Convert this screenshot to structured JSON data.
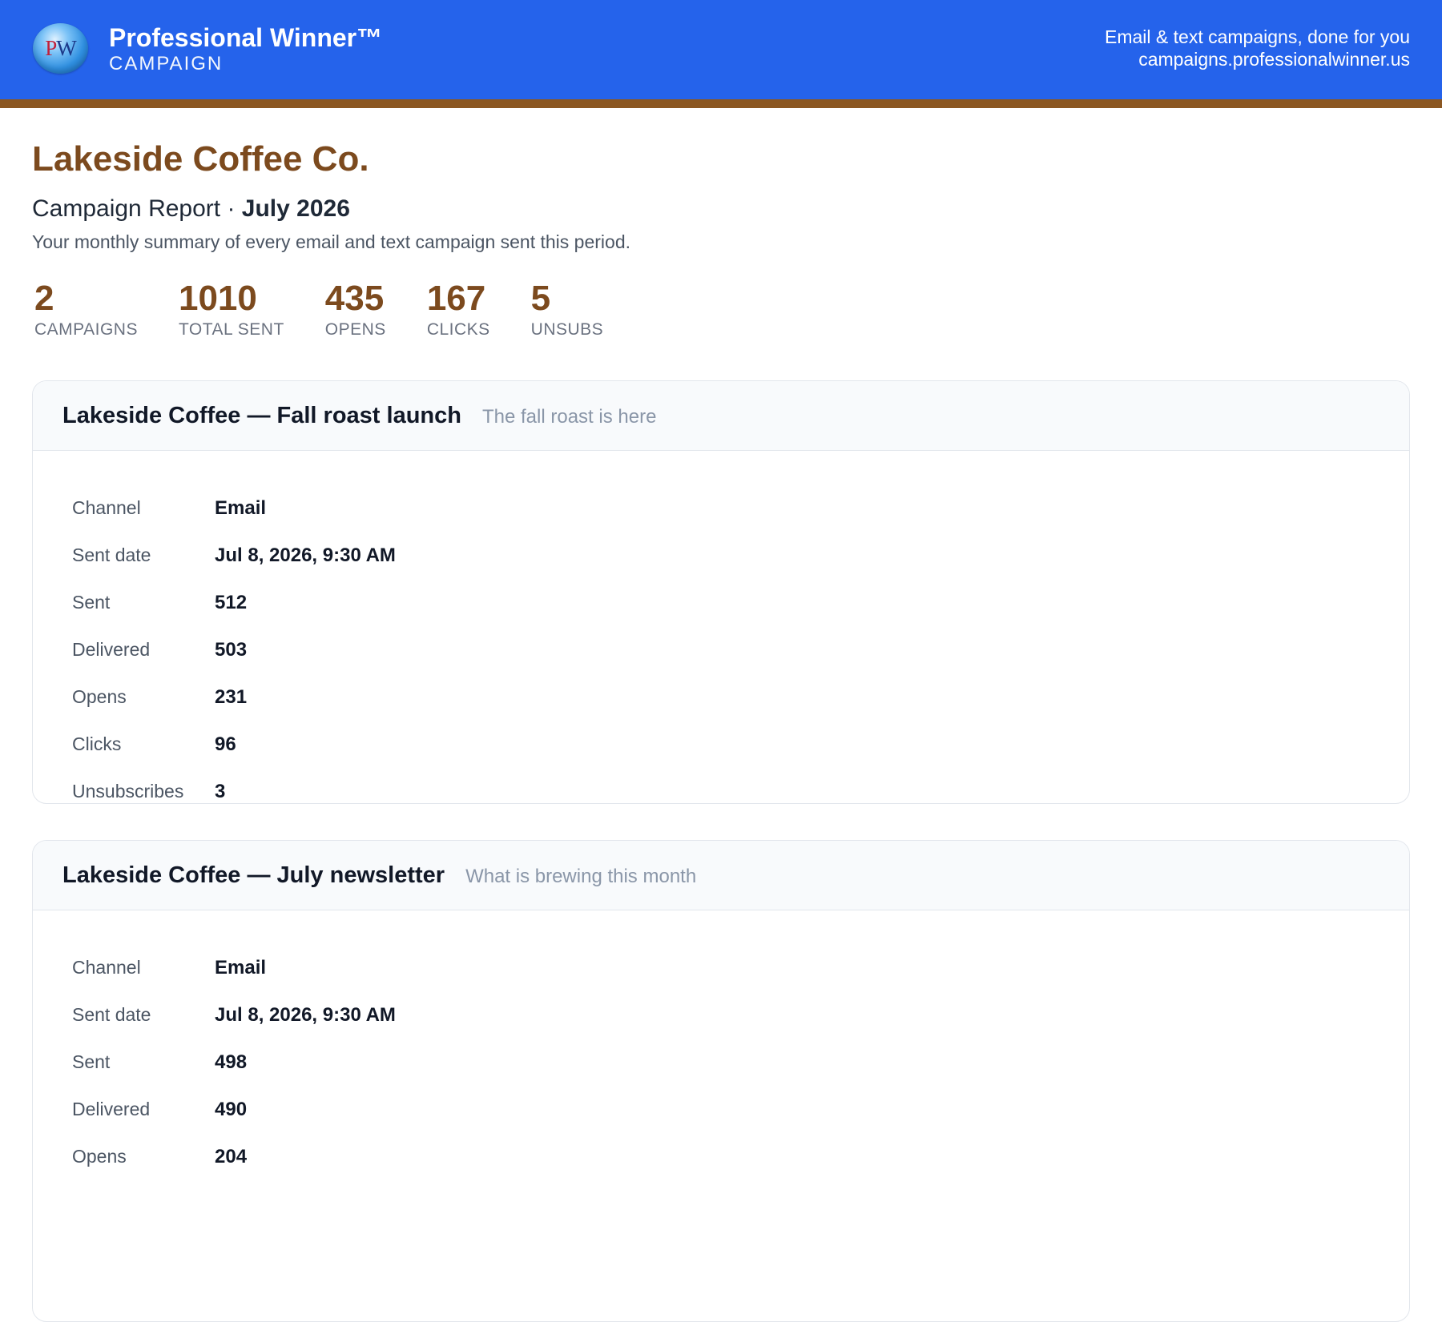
{
  "header": {
    "logo_text_p": "P",
    "logo_text_w": "W",
    "brand_name": "Professional Winner™",
    "brand_sub": "CAMPAIGN",
    "tagline": "Email & text campaigns, done for you",
    "site": "campaigns.professionalwinner.us",
    "colors": {
      "bar": "#2563eb",
      "accent": "#8b5722"
    }
  },
  "report": {
    "company": "Lakeside Coffee Co.",
    "title_prefix": "Campaign Report ·",
    "month": "July 2026",
    "summary": "Your monthly summary of every email and text campaign sent this period."
  },
  "stats": [
    {
      "value": "2",
      "label": "CAMPAIGNS"
    },
    {
      "value": "1010",
      "label": "TOTAL SENT"
    },
    {
      "value": "435",
      "label": "OPENS"
    },
    {
      "value": "167",
      "label": "CLICKS"
    },
    {
      "value": "5",
      "label": "UNSUBS"
    }
  ],
  "campaigns": [
    {
      "title": "Lakeside Coffee — Fall roast launch",
      "subject": "The fall roast is here",
      "rows": [
        {
          "label": "Channel",
          "value": "Email"
        },
        {
          "label": "Sent date",
          "value": "Jul 8, 2026, 9:30 AM"
        },
        {
          "label": "Sent",
          "value": "512"
        },
        {
          "label": "Delivered",
          "value": "503"
        },
        {
          "label": "Opens",
          "value": "231"
        },
        {
          "label": "Clicks",
          "value": "96"
        },
        {
          "label": "Unsubscribes",
          "value": "3"
        }
      ]
    },
    {
      "title": "Lakeside Coffee — July newsletter",
      "subject": "What is brewing this month",
      "rows": [
        {
          "label": "Channel",
          "value": "Email"
        },
        {
          "label": "Sent date",
          "value": "Jul 8, 2026, 9:30 AM"
        },
        {
          "label": "Sent",
          "value": "498"
        },
        {
          "label": "Delivered",
          "value": "490"
        },
        {
          "label": "Opens",
          "value": "204"
        }
      ]
    }
  ]
}
